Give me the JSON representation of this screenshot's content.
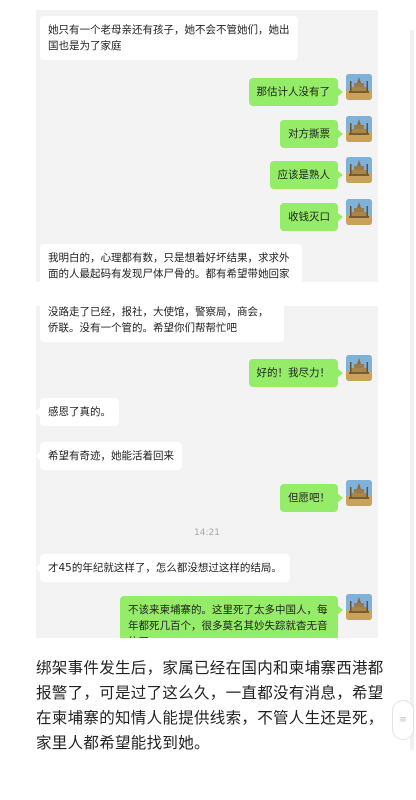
{
  "screenshot_1": {
    "messages": [
      {
        "side": "in",
        "text": "她只有一个老母亲还有孩子，她不会不管她们，她出国也是为了家庭"
      },
      {
        "side": "out",
        "text": "那估计人没有了"
      },
      {
        "side": "out",
        "text": "对方撕票"
      },
      {
        "side": "out",
        "text": "应该是熟人"
      },
      {
        "side": "out",
        "text": "收钱灭口"
      },
      {
        "side": "in",
        "text": "我明白的，心理都有数，只是想着好坏结果，求求外面的人最起码有发现尸体尸骨的。都有希望带她回家"
      }
    ]
  },
  "screenshot_2": {
    "messages": [
      {
        "side": "in",
        "text": "没路走了已经，报社，大使馆，警察局，商会，侨联。没有一个管的。希望你们帮帮忙吧"
      },
      {
        "side": "out",
        "text": "好的！我尽力！"
      },
      {
        "side": "in",
        "text": "感恩了真的。"
      },
      {
        "side": "in",
        "text": "希望有奇迹，她能活着回来"
      },
      {
        "side": "out",
        "text": "但愿吧！"
      },
      {
        "side": "in",
        "text": "才45的年纪就这样了，怎么都没想过这样的结局。"
      },
      {
        "side": "out",
        "text": "不该来柬埔寨的。这里死了太多中国人，每年都死几百个，很多莫名其妙失踪就杳无音信了"
      }
    ],
    "timestamp": "14:21"
  },
  "caption": "绑架事件发生后，家属已经在国内和柬埔寨西港都报警了，可是过了这么久，一直都没有消息，希望在柬埔寨的知情人能提供线索，不管人生还是死，家里人都希望能找到她。",
  "icons": {
    "avatar": "temple-avatar-icon",
    "side_handle": "scroll-handle-icon"
  },
  "colors": {
    "outgoing_bubble": "#95ec69",
    "incoming_bubble": "#ffffff",
    "chat_bg": "#f3f3f3"
  }
}
